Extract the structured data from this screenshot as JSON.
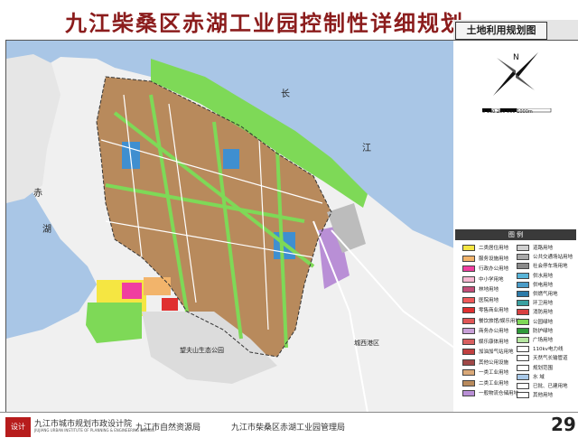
{
  "header": {
    "title": "九江柴桑区赤湖工业园控制性详细规划",
    "subtitle": "土地利用规划图"
  },
  "map": {
    "labels": {
      "yangtze_chang": "长",
      "yangtze_jiang": "江",
      "chihu_chi": "赤",
      "chihu_hu": "湖",
      "park": "望夫山生态公园",
      "town": "城西港区"
    }
  },
  "north_arrow": {
    "letter": "N"
  },
  "scale_bar": {
    "text": "0  100  200  500        1000m"
  },
  "legend": {
    "title": "图 例",
    "left_items": [
      {
        "label": "二类居住用地",
        "color": "#f5e642"
      },
      {
        "label": "服务设施用地",
        "color": "#f2b46b"
      },
      {
        "label": "行政办公用地",
        "color": "#f03ea0"
      },
      {
        "label": "中小学用地",
        "color": "#f7b8d2"
      },
      {
        "label": "林地用地",
        "color": "#c44f7a"
      },
      {
        "label": "医院用地",
        "color": "#f05a5a"
      },
      {
        "label": "零售商业用地",
        "color": "#e03030"
      },
      {
        "label": "餐饮旅馆/娱乐用地",
        "color": "#e05656"
      },
      {
        "label": "商务办公用地",
        "color": "#c8a0d8"
      },
      {
        "label": "娱乐康体用地",
        "color": "#d86060"
      },
      {
        "label": "加油加气站用地",
        "color": "#c04040"
      },
      {
        "label": "其他公用设施",
        "color": "#a04848"
      },
      {
        "label": "一类工业用地",
        "color": "#d9a878"
      },
      {
        "label": "二类工业用地",
        "color": "#b88a5c"
      },
      {
        "label": "一般物流仓储用地",
        "color": "#b98fd6"
      }
    ],
    "right_items": [
      {
        "label": "道路用地",
        "color": "#d0d0d0"
      },
      {
        "label": "公共交通场站用地",
        "color": "#a8a8a8"
      },
      {
        "label": "社会停车场用地",
        "color": "#8a8a8a"
      },
      {
        "label": "供水用地",
        "color": "#58b4d8"
      },
      {
        "label": "供电用地",
        "color": "#4a9cc8"
      },
      {
        "label": "供燃气用地",
        "color": "#2c7aa8"
      },
      {
        "label": "环卫用地",
        "color": "#3aa0a0"
      },
      {
        "label": "消防用地",
        "color": "#d84040"
      },
      {
        "label": "公园绿地",
        "color": "#7ed957"
      },
      {
        "label": "防护绿地",
        "color": "#2e9a3a"
      },
      {
        "label": "广场用地",
        "color": "#b5e6a0"
      },
      {
        "label": "110kv电力线",
        "color": "#ffffff"
      },
      {
        "label": "天然气长输管道",
        "color": "#ffffff"
      },
      {
        "label": "规划范围",
        "color": "#ffffff"
      },
      {
        "label": "水 域",
        "color": "#a8c8e8"
      },
      {
        "label": "已批、已建用地",
        "color": "#ffffff"
      },
      {
        "label": "其他用地",
        "color": "#ffffff"
      }
    ]
  },
  "footer": {
    "org1": "九江市城市规划市政设计院",
    "org1_en": "JIUJIANG URBAN INSTITUTE OF PLANNING & ENGINEERING DESIGN",
    "org2": "九江市自然资源局",
    "org3": "九江市柴桑区赤湖工业园管理局",
    "logo_text": "设计",
    "page": "29"
  },
  "colors": {
    "water": "#a9c6e6",
    "industrial": "#b88a5c",
    "green": "#7ed957",
    "title": "#8b1c1c"
  }
}
